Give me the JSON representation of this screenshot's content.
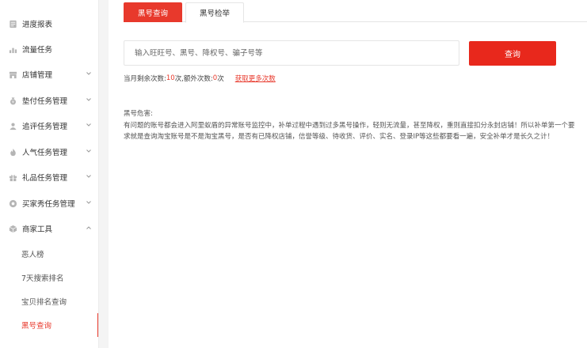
{
  "sidebar": {
    "items": [
      {
        "label": "进度报表",
        "icon": "report-icon",
        "has_chevron": false
      },
      {
        "label": "流量任务",
        "icon": "traffic-icon",
        "has_chevron": false
      },
      {
        "label": "店铺管理",
        "icon": "shop-icon",
        "has_chevron": true
      },
      {
        "label": "垫付任务管理",
        "icon": "advance-pay-icon",
        "has_chevron": true
      },
      {
        "label": "追评任务管理",
        "icon": "review-icon",
        "has_chevron": true
      },
      {
        "label": "人气任务管理",
        "icon": "fire-icon",
        "has_chevron": true
      },
      {
        "label": "礼品任务管理",
        "icon": "gift-icon",
        "has_chevron": true
      },
      {
        "label": "买家秀任务管理",
        "icon": "buyer-show-icon",
        "has_chevron": true
      },
      {
        "label": "商家工具",
        "icon": "toolbox-icon",
        "has_chevron": true,
        "expanded": true
      }
    ],
    "sub_items": [
      {
        "label": "恶人榜",
        "active": false
      },
      {
        "label": "7天搜索排名",
        "active": false
      },
      {
        "label": "宝贝排名查询",
        "active": false
      },
      {
        "label": "黑号查询",
        "active": true
      }
    ]
  },
  "tabs": [
    {
      "label": "黑号查询",
      "active": true
    },
    {
      "label": "黑号检举",
      "active": false
    }
  ],
  "search": {
    "value": "",
    "placeholder": "输入旺旺号、黑号、降权号、骗子号等",
    "button_label": "查询"
  },
  "quota": {
    "monthly_label": "当月剩余次数:",
    "monthly_count": "10",
    "monthly_unit": "次,额外次数:",
    "extra_count": "0",
    "extra_unit": "次",
    "more_link": "获取更多次数"
  },
  "danger": {
    "title": "黑号危害:",
    "text": "有问题的账号都会进入阿里蚁盾的异常账号监控中，补单过程中遇到过多黑号操作，轻则无流量，甚至降权，重则直接扣分永封店铺！所以补单第一个要求就是查询淘宝账号是不是淘宝黑号，是否有已降权店铺，信誉等级、待收货、评价、实名、登录IP等这些都要看一遍，安全补单才是长久之计！"
  },
  "colors": {
    "accent": "#e8392c",
    "button": "#e8281c"
  }
}
